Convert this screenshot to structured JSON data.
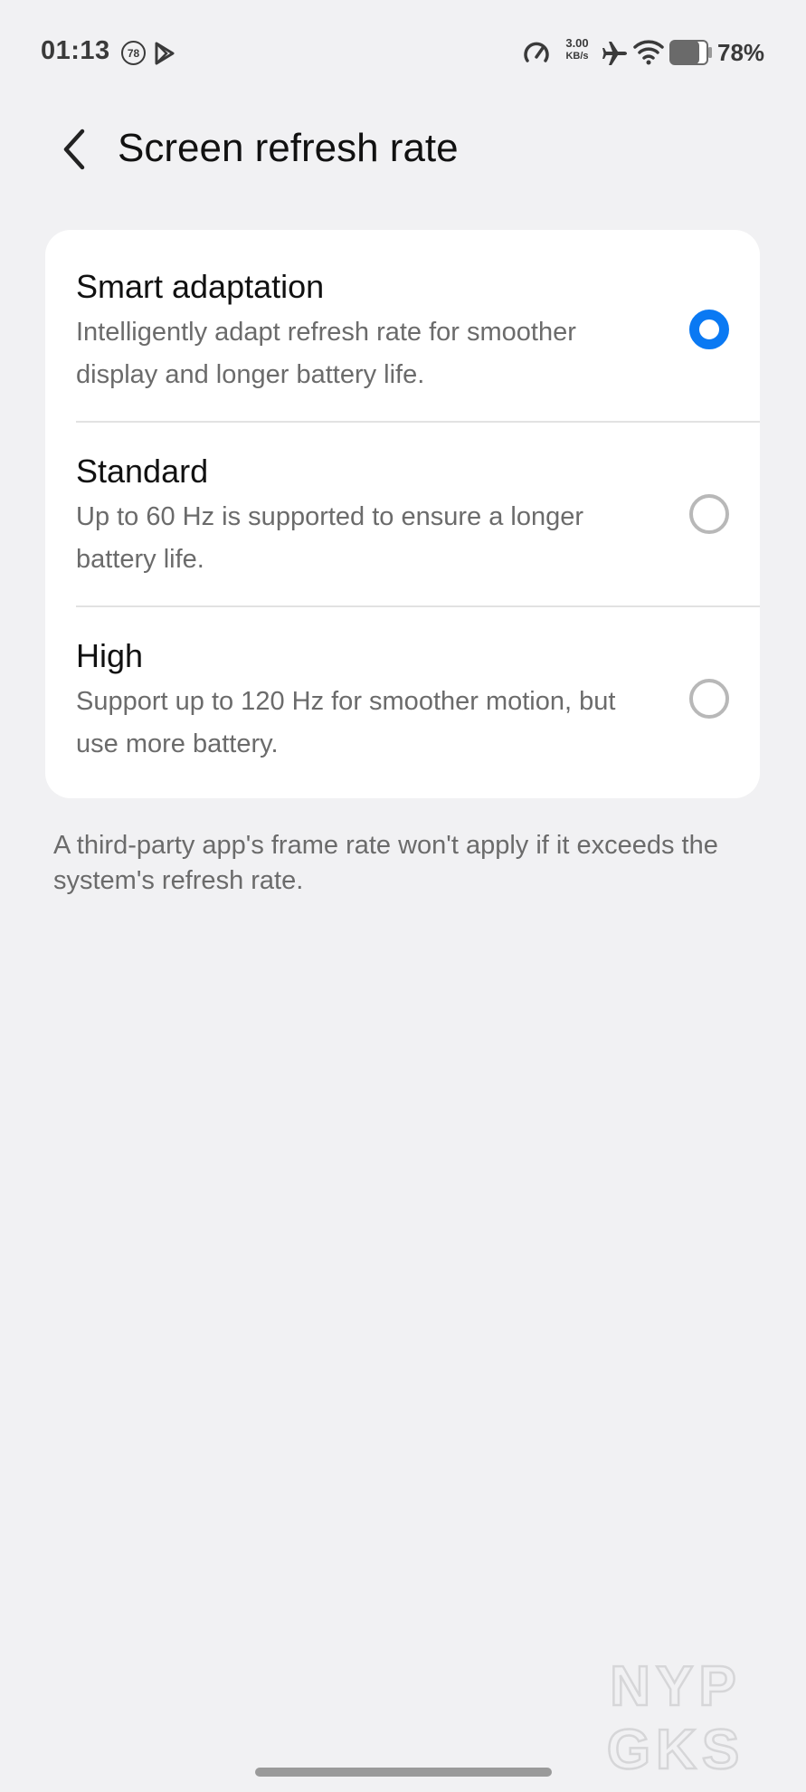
{
  "status_bar": {
    "time": "01:13",
    "notification_count": "78",
    "net_speed_value": "3.00",
    "net_speed_unit": "KB/s",
    "battery_percent": "78%",
    "battery_level": 0.78
  },
  "header": {
    "title": "Screen refresh rate"
  },
  "options": [
    {
      "title": "Smart adaptation",
      "description": "Intelligently adapt refresh rate for smoother display and longer battery life.",
      "selected": true
    },
    {
      "title": "Standard",
      "description": "Up to 60 Hz is supported to ensure a longer battery life.",
      "selected": false
    },
    {
      "title": "High",
      "description": "Support up to 120 Hz for smoother motion, but use more battery.",
      "selected": false
    }
  ],
  "footnote": "A third-party app's frame rate won't apply if it exceeds the system's refresh rate.",
  "watermark": {
    "line1": "NYP",
    "line2": "GKS"
  },
  "colors": {
    "accent": "#0a79f3",
    "background": "#f1f1f3",
    "card": "#ffffff",
    "secondary_text": "#6b6b6b"
  }
}
